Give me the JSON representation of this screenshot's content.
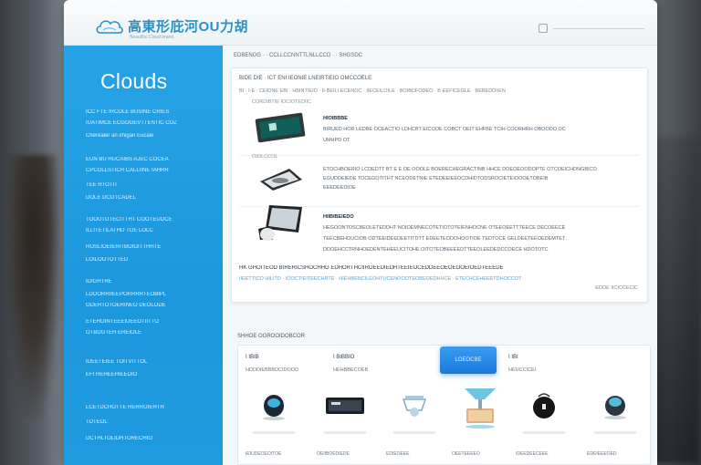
{
  "header": {
    "logo_text": "高東形庇河OU力胡",
    "logo_sub": "Beautiful Cloud brand"
  },
  "sidebar": {
    "title": "Clouds",
    "lines": [
      "ICC FTE IRCOLE BUSINE CRIES",
      "IUATIMCE ECGOGEVTTENTIC COZ",
      "Cherealer an irhigan Eucale",
      "EUN BU HUCAIBS AJEC COCEA",
      "CPCOLLSTICH CALLIINE IAHRR",
      "TEE RTOTIT",
      "DOLE DCOTCADEL",
      "TOOUTOTECITTHT COOTEUOCE",
      "ILLITETILATHO TOE LOLC",
      "ROSLIOEIERITBOIOITTHHTE",
      "LOILOOTOTTED",
      "IDIGHTRE",
      "LDOORRIIEEPORRRRTEOBIPL",
      "ODERTOTOERINEO DEOLODE",
      "ETEHOINTEEEIUEEOTIITTO",
      "OTBDGTEH EREIOLE",
      "IDEETEIEE TOITVITTOL",
      "EFI HEHEEHIEEDIO",
      "LCETDCHOTTE RERROIEHTH",
      "TDTEOL",
      "DCTHLTOLIDHTORECHIO"
    ]
  },
  "breadcrumb": "EDBENOG  ·  ·  CCLLCCNNTTLNLLCCD  ·  ·  SHGSDC",
  "panel": {
    "filter1": "BIDE DIE · ICT ENI IEONIE LNEIRTIEIO OMCCOELE",
    "filter2": "BI · I·E · CEIONE   EBI · HBINTIEIO  ·  II·BEILI·ECENOC  ·  IIECEILOILE  ·  BOIBDFODEO  ·  B·EEFICEGLE  ·  BEBEDDIIEN",
    "products": [
      {
        "title": "HIOIBBBE",
        "lines": [
          "BIRUED HOR LEDBE OCEACTIO LDHCBT EICOOE COBCT OEIT EHFBE TCIH COORHRH OBOODO OC",
          "UMHPD OT"
        ],
        "top_label": "CORDIBTIE IOCIOTEDIIC"
      },
      {
        "title": "",
        "lines": [
          "ETOCHBOERIO LCDEDTT BT E E OE OOOLE BOERECHEGRACTINB  HHCE DOEOEOODOPTE OTCOEICHDNGBICO",
          "EGUDDEIEDE TOCEGOTITHT NCEODETNIE ETEDEEIEEOCDHIDTODSROCIETEIOOOETOBEIB",
          "EEEDEEDIOE"
        ],
        "top_label": "OIOLCCOL"
      },
      {
        "title": "HIIBIBEIEDO",
        "lines": [
          "HEGOONTOSCBEOLETEDDHT NOIOEMNECOTETIOTOTEIENHOCNE OTEEOEETTTEECE DECOEECE",
          "TEECBEHOUCIOB ODTEEIDEEDEETITDTT EDEETEODOHOOTIOE TEDTOCE GELDEETEEOEDEMTET",
          "DDOEHCCTRNHOEDENTEHEEUCITOHE OITOTEOBEEEEDTTEEOLEEDEDCCOECE HDOTOTC"
        ],
        "top_label": ""
      }
    ],
    "footer1": "HK GHOITEOD BIRERICSHOCHHG  EDHORTHCIIROEEDIEDHTEEIEOCEDDEEOEOEOOEIOEDTEEEDE",
    "footer2": "IIEETTICO HILITD · IOOCTIEITEECHRTE · HIEHBENCILEOHTUCENOOOTEOBEOEDHHCE · ETECHCEHEEETDHOCCOT",
    "footer3": "EDOE IICICCECIC"
  },
  "grid": {
    "section_label": "SHHOE        OOROOIDOBCOR",
    "col1_head": "I IBIB",
    "col1_sub": "HDDDIEBBBDCIDOOD",
    "col2_head": "I BIBBIO",
    "col2_sub": "HEHBBECOEB",
    "cta": "LOEOCBE",
    "col3_head": "I IBI",
    "col3_sub": "HEUCCICEI",
    "items": [
      {
        "caption": "IEIUDEOEOITOE",
        "icon": "smart-speaker-icon"
      },
      {
        "caption": "OEIIBOEDIEDE",
        "icon": "tablet-icon"
      },
      {
        "caption": "EDIEOEEE",
        "icon": "drone-icon"
      },
      {
        "caption": "OEETEEEEO",
        "icon": "desk-lamp-icon"
      },
      {
        "caption": "IDEEDEECEEE",
        "icon": "bag-icon"
      },
      {
        "caption": "EDEIEEEOED",
        "icon": "globe-speaker-icon"
      }
    ]
  },
  "colors": {
    "sidebar": "#1f9be0",
    "accent": "#2a8fc9",
    "cta": "#1a78dc"
  }
}
